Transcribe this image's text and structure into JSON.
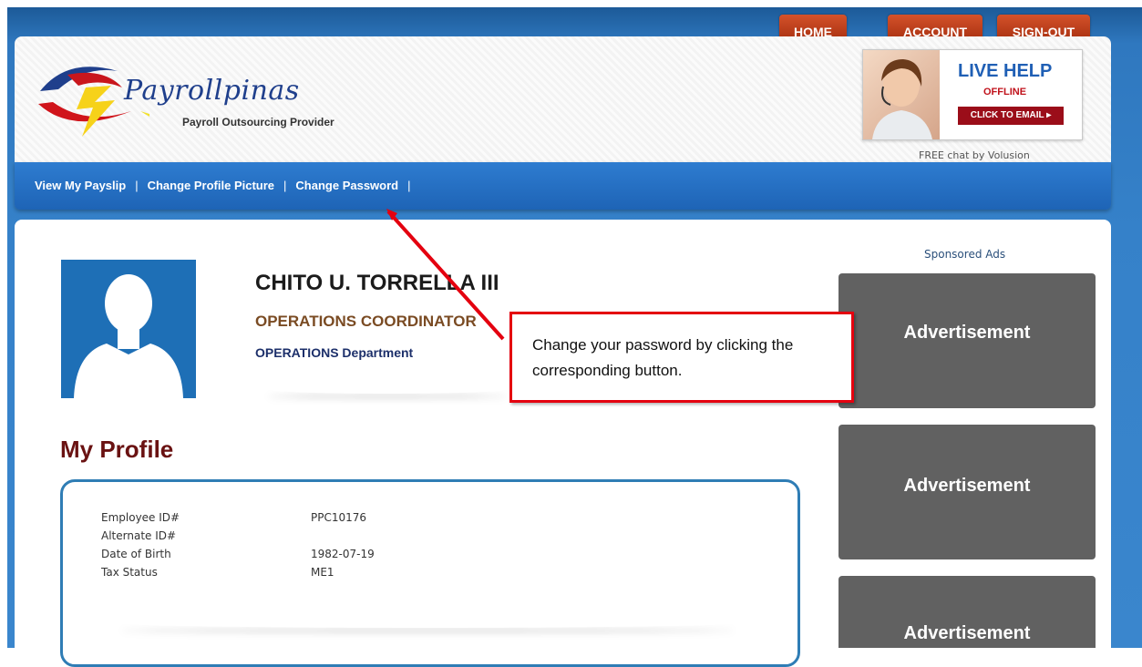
{
  "top_nav": [
    "HOME",
    "ACCOUNT",
    "SIGN-OUT"
  ],
  "brand": {
    "name": "Payrollpinas",
    "tagline": "Payroll Outsourcing Provider"
  },
  "live_help": {
    "title": "LIVE HELP",
    "status": "OFFLINE",
    "button": "CLICK TO EMAIL ▸",
    "credit": "FREE chat by Volusion"
  },
  "sub_nav": [
    "View My Payslip",
    "Change Profile Picture",
    "Change Password"
  ],
  "employee": {
    "name": "CHITO U. TORRELLA III",
    "position": "OPERATIONS COORDINATOR",
    "department": "OPERATIONS Department"
  },
  "profile": {
    "heading": "My Profile",
    "rows": [
      {
        "label": "Employee ID#",
        "value": "PPC10176"
      },
      {
        "label": "Alternate ID#",
        "value": ""
      },
      {
        "label": "Date of Birth",
        "value": "1982-07-19"
      },
      {
        "label": "Tax Status",
        "value": "ME1"
      }
    ]
  },
  "ads": {
    "heading": "Sponsored Ads",
    "items": [
      "Advertisement",
      "Advertisement",
      "Advertisement"
    ]
  },
  "callout": {
    "text": "Change your password by clicking the corresponding button."
  }
}
